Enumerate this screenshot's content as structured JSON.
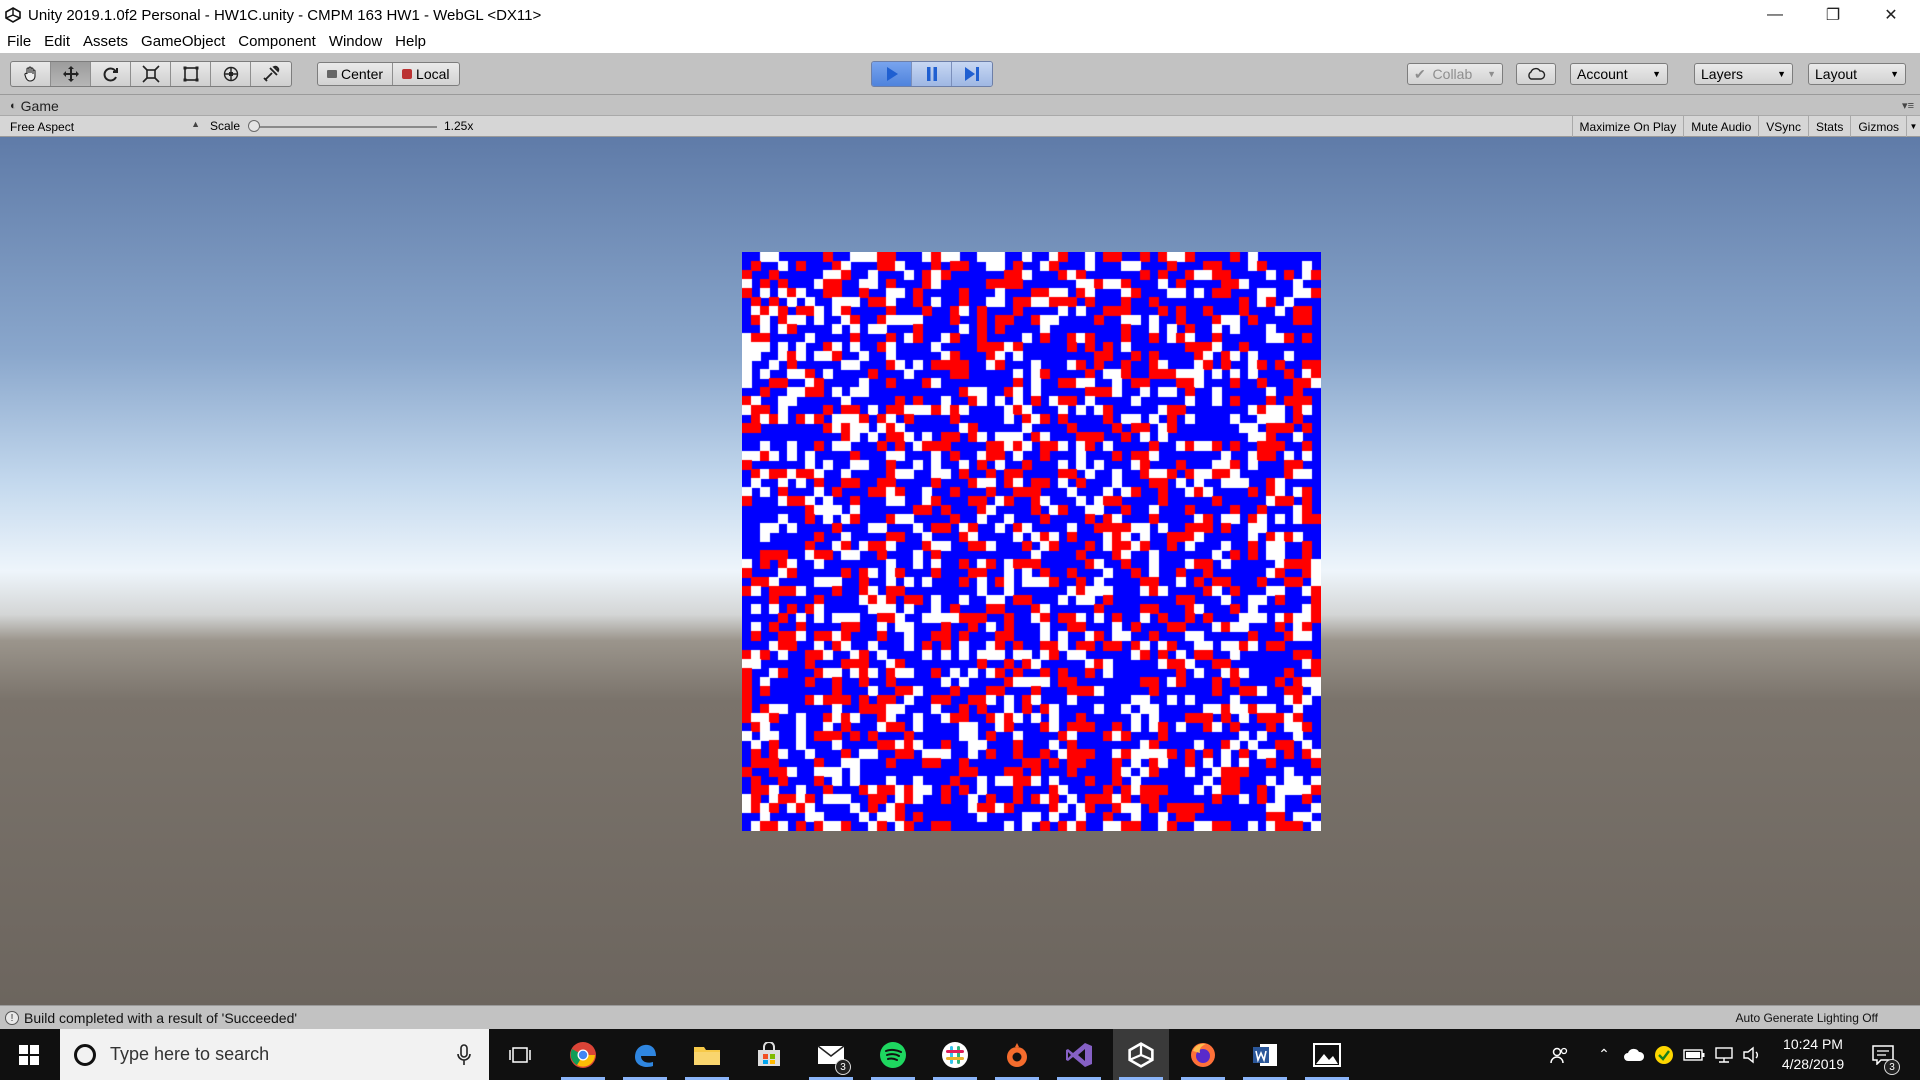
{
  "window": {
    "title": "Unity 2019.1.0f2 Personal - HW1C.unity - CMPM 163 HW1 - WebGL <DX11>",
    "minimize": "—",
    "restore": "❐",
    "close": "✕"
  },
  "menu": [
    "File",
    "Edit",
    "Assets",
    "GameObject",
    "Component",
    "Window",
    "Help"
  ],
  "toolbar": {
    "tools": [
      "hand-tool",
      "move-tool",
      "rotate-tool",
      "scale-tool",
      "rect-tool",
      "transform-tool",
      "custom-tool"
    ],
    "active_tool": "move-tool",
    "pivot_label": "Center",
    "rotation_label": "Local",
    "play_active": true,
    "collab_label": "Collab",
    "account_label": "Account",
    "layers_label": "Layers",
    "layout_label": "Layout",
    "accent_color": "#4f83dc"
  },
  "game_tab": {
    "label": "Game",
    "aspect": "Free Aspect",
    "scale_label": "Scale",
    "scale_value": "1.25x",
    "scale_fraction": 0.0,
    "toggles": [
      "Maximize On Play",
      "Mute Audio",
      "VSync",
      "Stats",
      "Gizmos"
    ]
  },
  "scene": {
    "grid_cells_per_side": 64,
    "colors": {
      "blue": "#0000ff",
      "red": "#ff0000",
      "white": "#ffffff"
    },
    "seed": 163
  },
  "status": {
    "message": "Build completed with a result of 'Succeeded'",
    "right": "Auto Generate Lighting Off"
  },
  "taskbar": {
    "search_placeholder": "Type here to search",
    "mail_badge": "3",
    "time": "10:24 PM",
    "date": "4/28/2019",
    "notification_badge": "3"
  }
}
